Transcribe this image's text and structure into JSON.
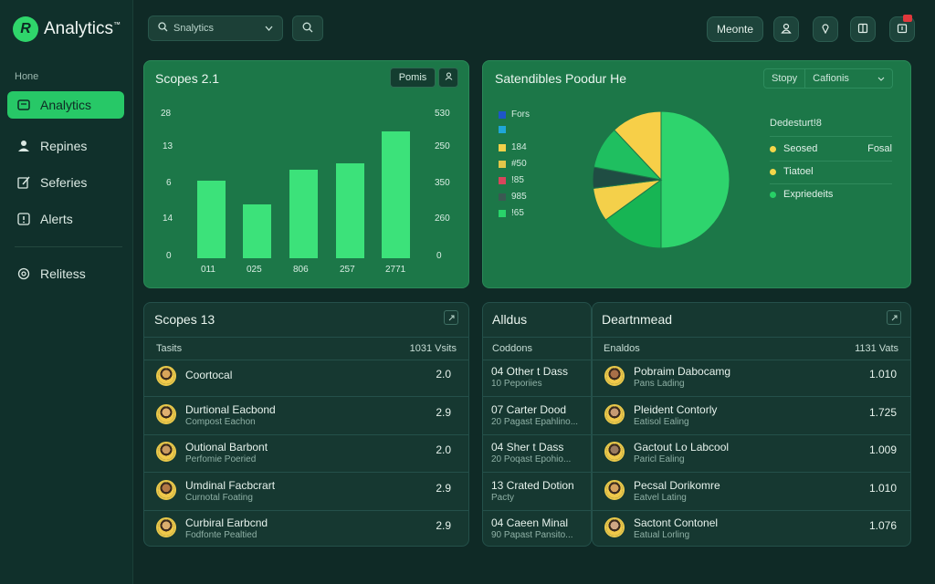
{
  "app": {
    "logo_letter": "R",
    "title": "Analytics",
    "title_sup": "™"
  },
  "sidebar": {
    "section": "Hone",
    "items": [
      {
        "label": "Analytics",
        "icon": "window-icon"
      },
      {
        "label": "Repines",
        "icon": "person-icon"
      },
      {
        "label": "Seferies",
        "icon": "edit-icon"
      },
      {
        "label": "Alerts",
        "icon": "alert-icon"
      },
      {
        "label": "Relitess",
        "icon": "at-icon"
      }
    ]
  },
  "topbar": {
    "search_value": "Snalytics",
    "pill_label": "Meonte"
  },
  "bar_panel": {
    "title": "Scopes 2.1",
    "button_label": "Pomis",
    "left_ticks": [
      "28",
      "13",
      "6",
      "14",
      "0"
    ],
    "right_ticks": [
      "530",
      "250",
      "350",
      "260",
      "0"
    ]
  },
  "chart_data": {
    "type": "bar",
    "categories": [
      "011",
      "025",
      "806",
      "257",
      "2771"
    ],
    "values": [
      6.4,
      4.4,
      7.3,
      7.8,
      10.4
    ],
    "ylim": [
      0,
      12
    ]
  },
  "pie_panel": {
    "title": "Satendibles Poodur He",
    "select_label": "Stopy",
    "select_value": "Cafionis",
    "legend_left": [
      {
        "label": "Fors",
        "color": "#1e56c8"
      },
      {
        "label": "",
        "color": "#1fa6d8"
      },
      {
        "label": "184",
        "color": "#f1d14a"
      },
      {
        "label": "#50",
        "color": "#e2c64a"
      },
      {
        "label": "!85",
        "color": "#d8455c"
      },
      {
        "label": "985",
        "color": "#3a5a52"
      },
      {
        "label": "!65",
        "color": "#29d36a"
      }
    ],
    "legend_title": "Dedesturt!8",
    "legend_right": [
      {
        "label": "Seosed",
        "value": "Fosal",
        "color": "#f4d64a"
      },
      {
        "label": "Tiatoel",
        "value": "",
        "color": "#f4d64a"
      },
      {
        "label": "Expriedeits",
        "value": "",
        "color": "#27d066"
      }
    ],
    "slices": [
      {
        "value": 50,
        "color": "#2ed46d"
      },
      {
        "value": 15,
        "color": "#17b554"
      },
      {
        "value": 8,
        "color": "#f4d04a"
      },
      {
        "value": 5,
        "color": "#1f4d43"
      },
      {
        "value": 10,
        "color": "#1fbf60"
      },
      {
        "value": 12,
        "color": "#f7cf48"
      }
    ]
  },
  "list1": {
    "title": "Scopes 13",
    "col_left": "Tasits",
    "col_right": "1031 Vsits",
    "rows": [
      {
        "title": "Coortocal",
        "sub": "",
        "value": "2.0",
        "skin": "#d9a45a"
      },
      {
        "title": "Durtional Eacbond",
        "sub": "Compost Eachon",
        "value": "2.9",
        "skin": "#e0b070"
      },
      {
        "title": "Outional Barbont",
        "sub": "Perfomie Poeried",
        "value": "2.0",
        "skin": "#c99a60"
      },
      {
        "title": "Umdinal Facbcrart",
        "sub": "Curnotal Foating",
        "value": "2.9",
        "skin": "#b47845"
      },
      {
        "title": "Curbiral Earbcnd",
        "sub": "Fodfonte Pealtied",
        "value": "2.9",
        "skin": "#dcae6e"
      }
    ]
  },
  "list2": {
    "title": "Alldus",
    "col_left": "Coddons",
    "rows": [
      {
        "title": "04 Other t Dass",
        "sub": "10 Peporiies"
      },
      {
        "title": "07 Carter Dood",
        "sub": "20 Pagast Epahlino..."
      },
      {
        "title": "04 Sher t Dass",
        "sub": "20 Poqast Epohio..."
      },
      {
        "title": "13 Crated Dotion",
        "sub": "Pacty"
      },
      {
        "title": "04 Caeen Minal",
        "sub": "90 Papast Pansito..."
      }
    ]
  },
  "list3": {
    "title": "Deartnmead",
    "col_left": "Enaldos",
    "col_right": "1131 Vats",
    "rows": [
      {
        "title": "Pobraim Dabocamg",
        "sub": "Pans Lading",
        "value": "1.010",
        "skin": "#a86f48"
      },
      {
        "title": "Pleident Contorly",
        "sub": "Eatisol Ealing",
        "value": "1.725",
        "skin": "#c79a72"
      },
      {
        "title": "Gactout Lo Labcool",
        "sub": "Paricl Ealing",
        "value": "1.009",
        "skin": "#9a7a60"
      },
      {
        "title": "Pecsal Dorikomre",
        "sub": "Eatvel Lating",
        "value": "1.010",
        "skin": "#d4a15e"
      },
      {
        "title": "Sactont Contonel",
        "sub": "Eatual Lorling",
        "value": "1.076",
        "skin": "#cfa684"
      }
    ]
  }
}
